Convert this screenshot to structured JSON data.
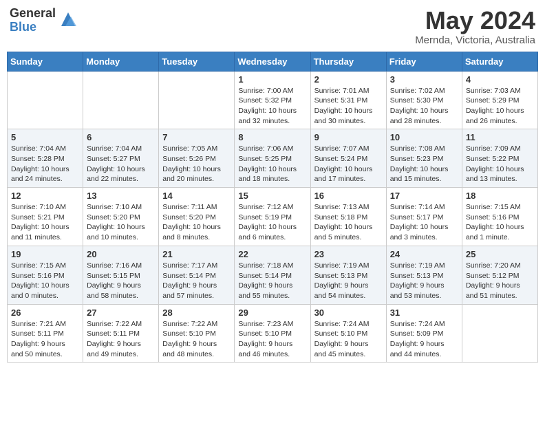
{
  "header": {
    "logo_general": "General",
    "logo_blue": "Blue",
    "month_title": "May 2024",
    "location": "Mernda, Victoria, Australia"
  },
  "weekdays": [
    "Sunday",
    "Monday",
    "Tuesday",
    "Wednesday",
    "Thursday",
    "Friday",
    "Saturday"
  ],
  "weeks": [
    [
      {
        "day": "",
        "info": ""
      },
      {
        "day": "",
        "info": ""
      },
      {
        "day": "",
        "info": ""
      },
      {
        "day": "1",
        "info": "Sunrise: 7:00 AM\nSunset: 5:32 PM\nDaylight: 10 hours\nand 32 minutes."
      },
      {
        "day": "2",
        "info": "Sunrise: 7:01 AM\nSunset: 5:31 PM\nDaylight: 10 hours\nand 30 minutes."
      },
      {
        "day": "3",
        "info": "Sunrise: 7:02 AM\nSunset: 5:30 PM\nDaylight: 10 hours\nand 28 minutes."
      },
      {
        "day": "4",
        "info": "Sunrise: 7:03 AM\nSunset: 5:29 PM\nDaylight: 10 hours\nand 26 minutes."
      }
    ],
    [
      {
        "day": "5",
        "info": "Sunrise: 7:04 AM\nSunset: 5:28 PM\nDaylight: 10 hours\nand 24 minutes."
      },
      {
        "day": "6",
        "info": "Sunrise: 7:04 AM\nSunset: 5:27 PM\nDaylight: 10 hours\nand 22 minutes."
      },
      {
        "day": "7",
        "info": "Sunrise: 7:05 AM\nSunset: 5:26 PM\nDaylight: 10 hours\nand 20 minutes."
      },
      {
        "day": "8",
        "info": "Sunrise: 7:06 AM\nSunset: 5:25 PM\nDaylight: 10 hours\nand 18 minutes."
      },
      {
        "day": "9",
        "info": "Sunrise: 7:07 AM\nSunset: 5:24 PM\nDaylight: 10 hours\nand 17 minutes."
      },
      {
        "day": "10",
        "info": "Sunrise: 7:08 AM\nSunset: 5:23 PM\nDaylight: 10 hours\nand 15 minutes."
      },
      {
        "day": "11",
        "info": "Sunrise: 7:09 AM\nSunset: 5:22 PM\nDaylight: 10 hours\nand 13 minutes."
      }
    ],
    [
      {
        "day": "12",
        "info": "Sunrise: 7:10 AM\nSunset: 5:21 PM\nDaylight: 10 hours\nand 11 minutes."
      },
      {
        "day": "13",
        "info": "Sunrise: 7:10 AM\nSunset: 5:20 PM\nDaylight: 10 hours\nand 10 minutes."
      },
      {
        "day": "14",
        "info": "Sunrise: 7:11 AM\nSunset: 5:20 PM\nDaylight: 10 hours\nand 8 minutes."
      },
      {
        "day": "15",
        "info": "Sunrise: 7:12 AM\nSunset: 5:19 PM\nDaylight: 10 hours\nand 6 minutes."
      },
      {
        "day": "16",
        "info": "Sunrise: 7:13 AM\nSunset: 5:18 PM\nDaylight: 10 hours\nand 5 minutes."
      },
      {
        "day": "17",
        "info": "Sunrise: 7:14 AM\nSunset: 5:17 PM\nDaylight: 10 hours\nand 3 minutes."
      },
      {
        "day": "18",
        "info": "Sunrise: 7:15 AM\nSunset: 5:16 PM\nDaylight: 10 hours\nand 1 minute."
      }
    ],
    [
      {
        "day": "19",
        "info": "Sunrise: 7:15 AM\nSunset: 5:16 PM\nDaylight: 10 hours\nand 0 minutes."
      },
      {
        "day": "20",
        "info": "Sunrise: 7:16 AM\nSunset: 5:15 PM\nDaylight: 9 hours\nand 58 minutes."
      },
      {
        "day": "21",
        "info": "Sunrise: 7:17 AM\nSunset: 5:14 PM\nDaylight: 9 hours\nand 57 minutes."
      },
      {
        "day": "22",
        "info": "Sunrise: 7:18 AM\nSunset: 5:14 PM\nDaylight: 9 hours\nand 55 minutes."
      },
      {
        "day": "23",
        "info": "Sunrise: 7:19 AM\nSunset: 5:13 PM\nDaylight: 9 hours\nand 54 minutes."
      },
      {
        "day": "24",
        "info": "Sunrise: 7:19 AM\nSunset: 5:13 PM\nDaylight: 9 hours\nand 53 minutes."
      },
      {
        "day": "25",
        "info": "Sunrise: 7:20 AM\nSunset: 5:12 PM\nDaylight: 9 hours\nand 51 minutes."
      }
    ],
    [
      {
        "day": "26",
        "info": "Sunrise: 7:21 AM\nSunset: 5:11 PM\nDaylight: 9 hours\nand 50 minutes."
      },
      {
        "day": "27",
        "info": "Sunrise: 7:22 AM\nSunset: 5:11 PM\nDaylight: 9 hours\nand 49 minutes."
      },
      {
        "day": "28",
        "info": "Sunrise: 7:22 AM\nSunset: 5:10 PM\nDaylight: 9 hours\nand 48 minutes."
      },
      {
        "day": "29",
        "info": "Sunrise: 7:23 AM\nSunset: 5:10 PM\nDaylight: 9 hours\nand 46 minutes."
      },
      {
        "day": "30",
        "info": "Sunrise: 7:24 AM\nSunset: 5:10 PM\nDaylight: 9 hours\nand 45 minutes."
      },
      {
        "day": "31",
        "info": "Sunrise: 7:24 AM\nSunset: 5:09 PM\nDaylight: 9 hours\nand 44 minutes."
      },
      {
        "day": "",
        "info": ""
      }
    ]
  ]
}
